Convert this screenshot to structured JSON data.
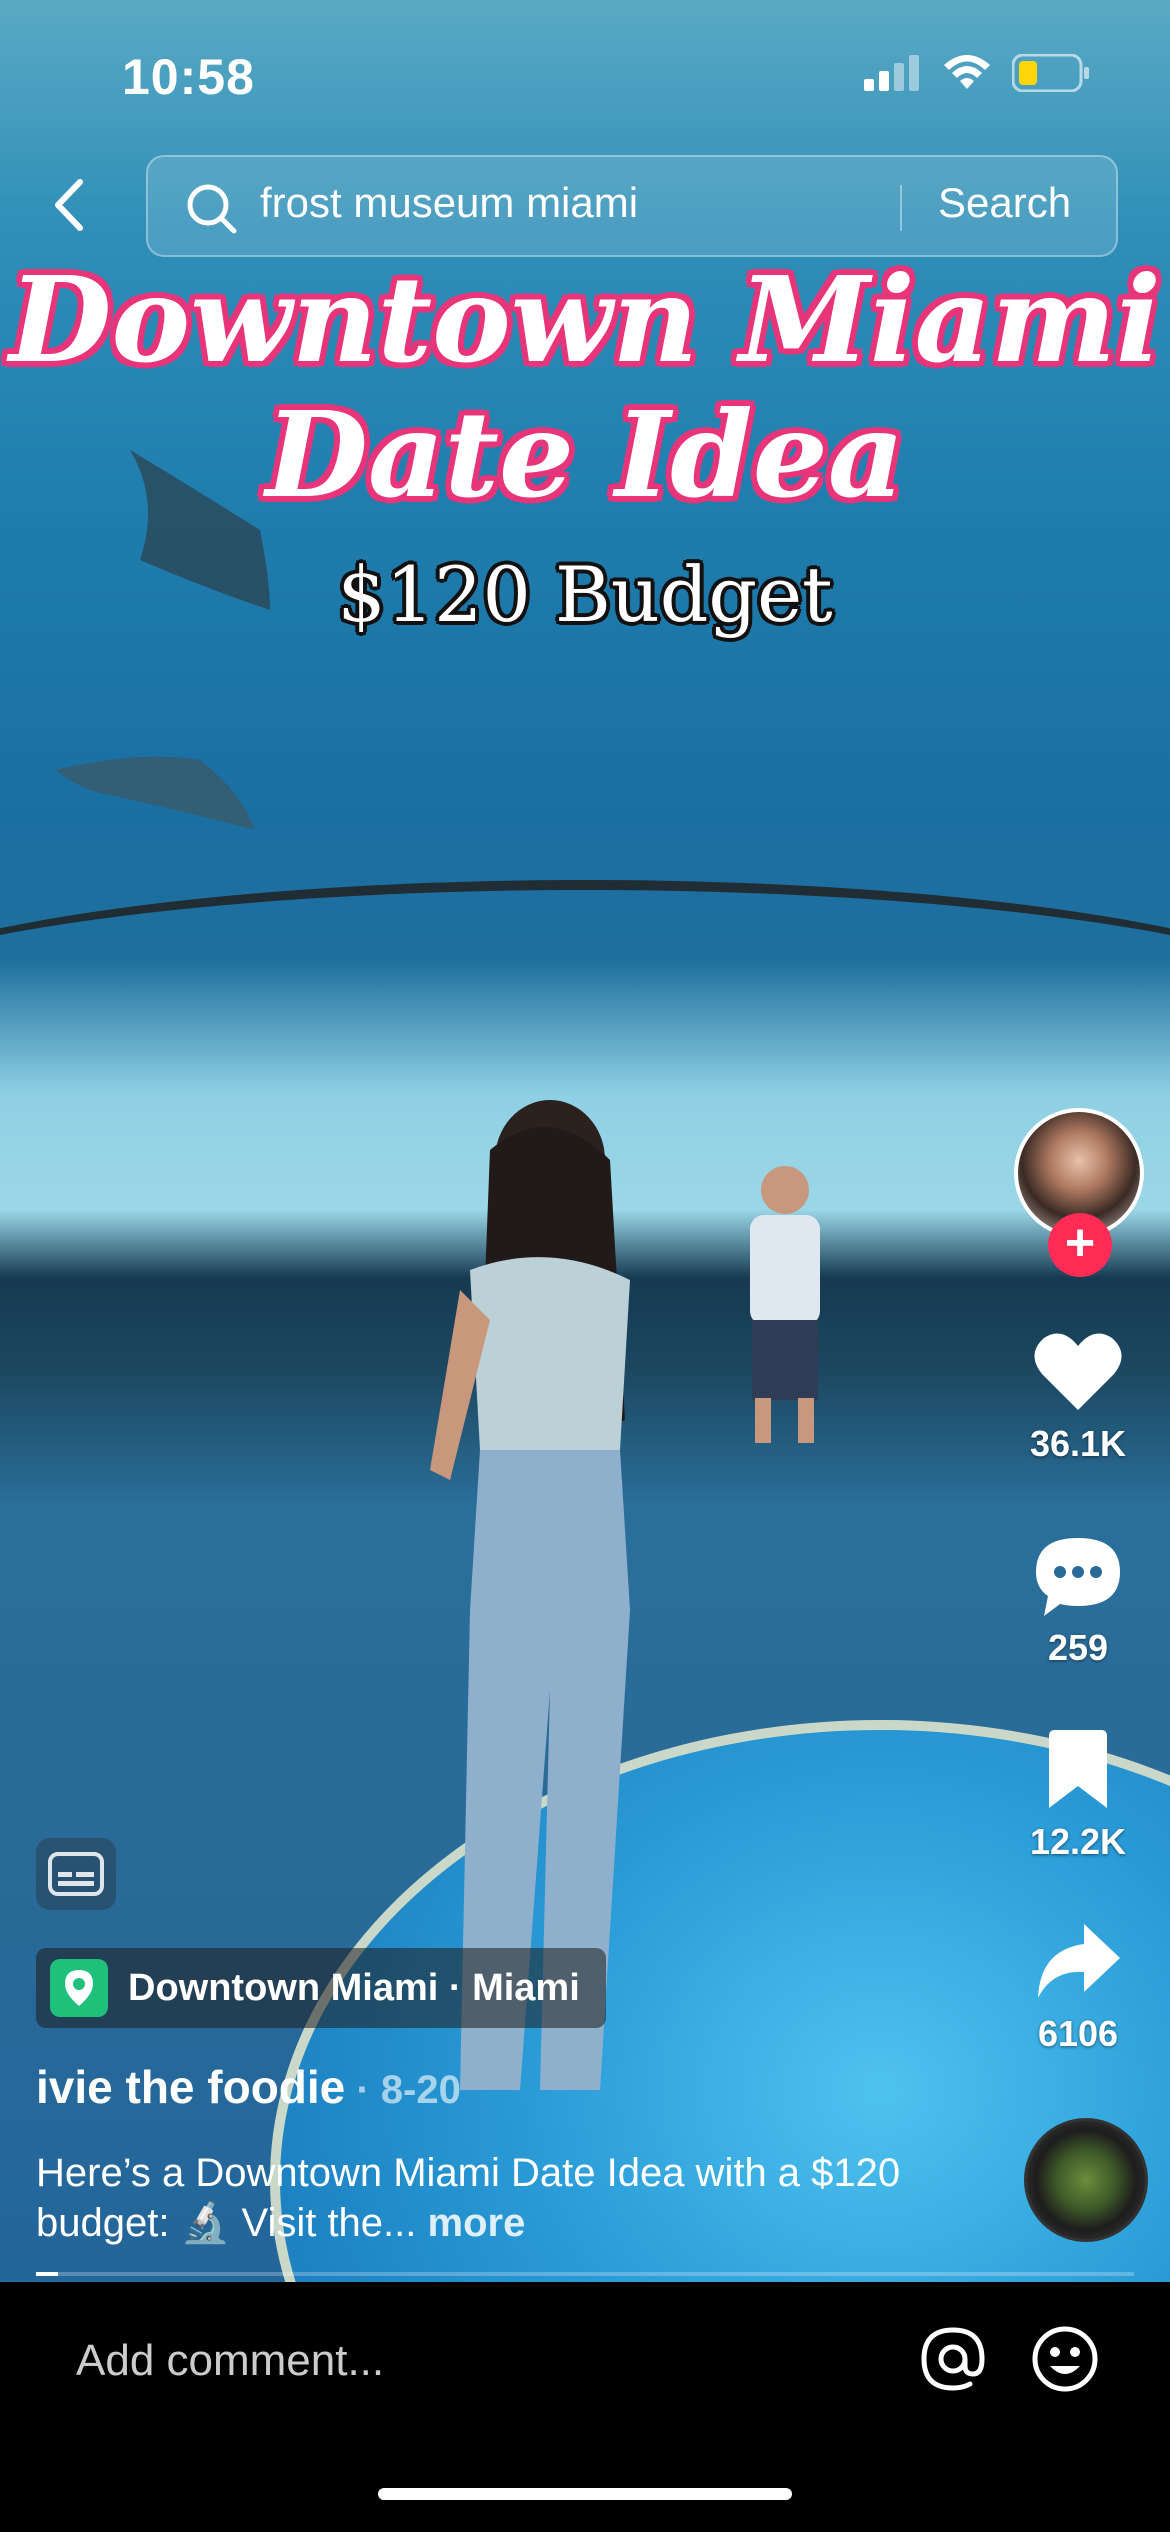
{
  "status": {
    "time": "10:58"
  },
  "search": {
    "query": "frost museum miami",
    "button_label": "Search"
  },
  "overlay": {
    "title_line1": "Downtown Miami",
    "title_line2": "Date Idea",
    "budget": "$120 Budget"
  },
  "rail": {
    "likes": "36.1K",
    "comments": "259",
    "saves": "12.2K",
    "shares": "6106",
    "follow_symbol": "+"
  },
  "post": {
    "location": "Downtown Miami · Miami",
    "author": "ivie the foodie",
    "date": " · 8-20",
    "description": "Here’s a Downtown Miami Date Idea with a $120 budget: 🔬 Visit the...",
    "more_label": "more",
    "progress_fraction": 0.02
  },
  "comment": {
    "placeholder": "Add comment..."
  },
  "colors": {
    "accent": "#fe2c55",
    "title_outline": "#e8357a",
    "location_pin": "#1ec07a"
  }
}
